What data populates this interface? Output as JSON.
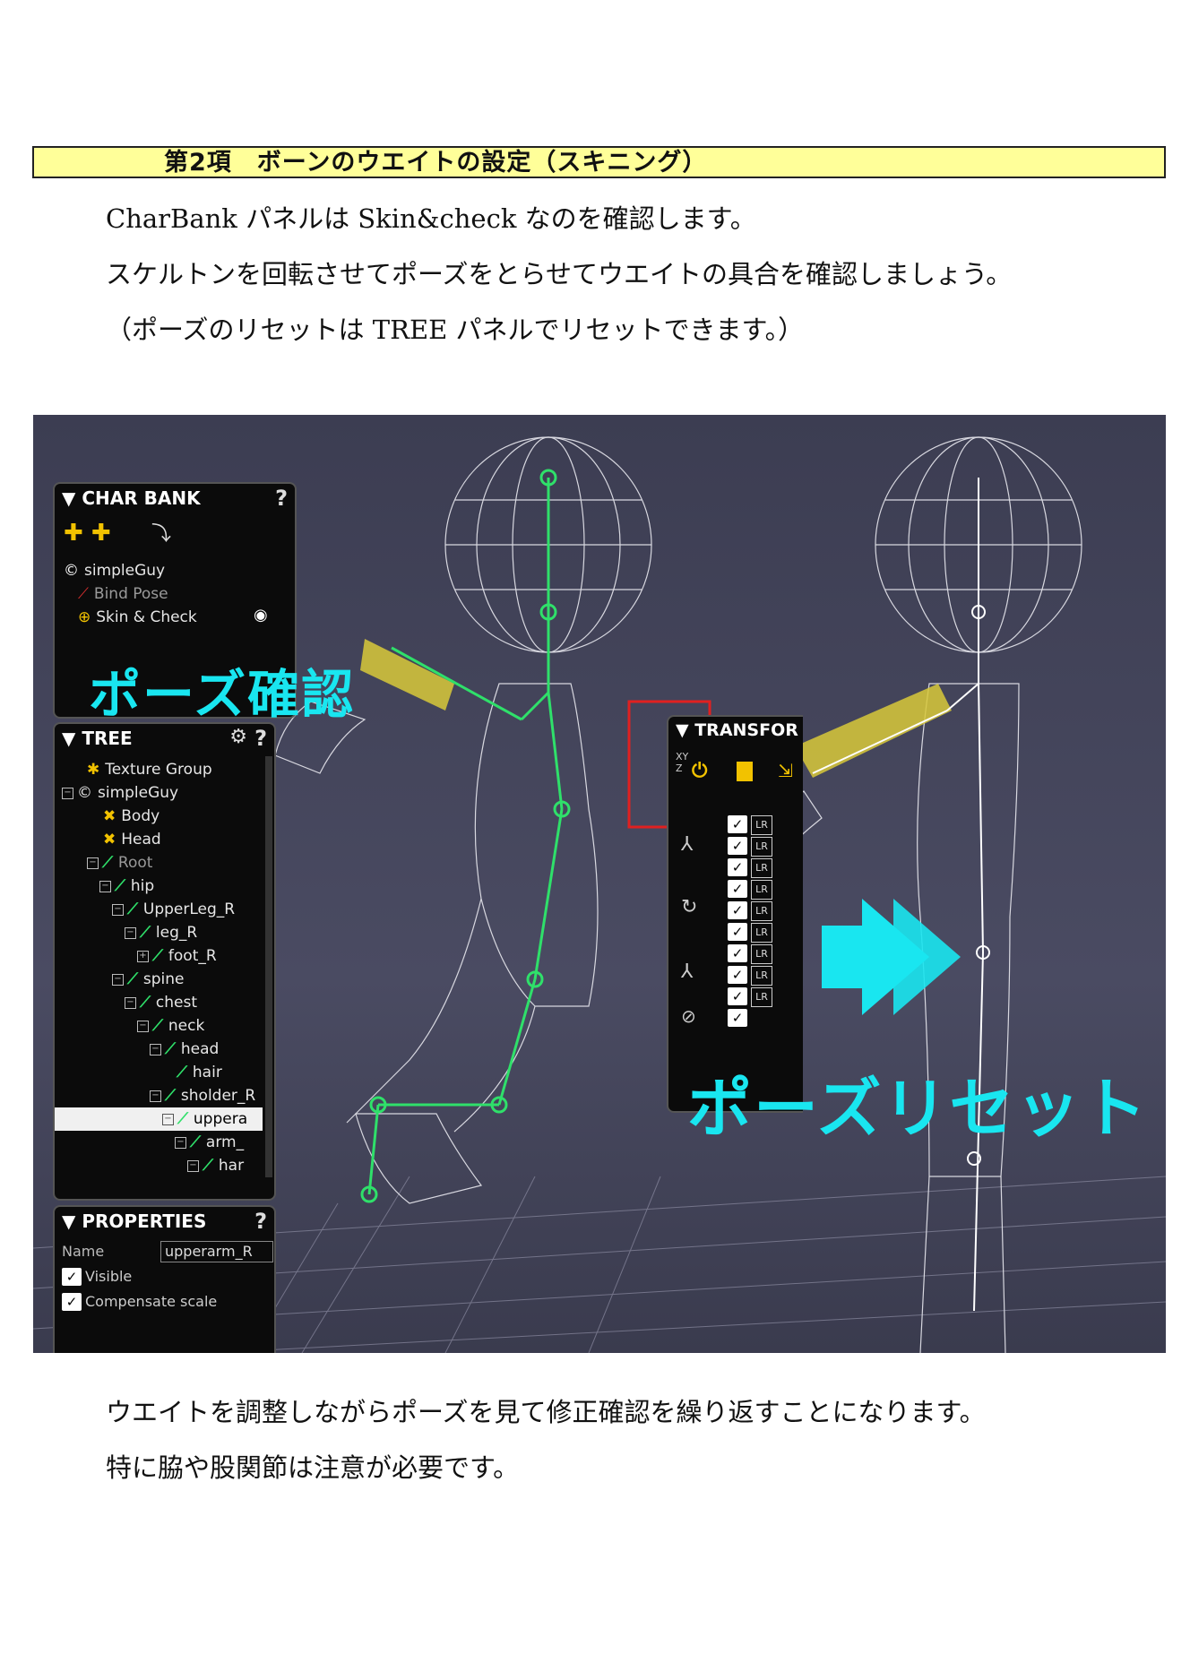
{
  "section": {
    "title": "第2項　ボーンのウエイトの設定（スキニング）"
  },
  "intro": [
    "CharBank パネルは Skin&check なのを確認します。",
    "スケルトンを回転させてポーズをとらせてウエイトの具合を確認しましょう。",
    "（ポーズのリセットは TREE パネルでリセットできます。）"
  ],
  "screenshot": {
    "charbank": {
      "title": "▼ CHAR BANK",
      "help": "?",
      "items": [
        "simpleGuy",
        "Bind Pose",
        "Skin & Check"
      ]
    },
    "tree": {
      "title": "▼ TREE",
      "help": "?",
      "rows": [
        "Texture Group",
        "simpleGuy",
        "Body",
        "Head",
        "Root",
        "hip",
        "UpperLeg_R",
        "leg_R",
        "foot_R",
        "spine",
        "chest",
        "neck",
        "head",
        "hair",
        "sholder_R",
        "uppera",
        "arm_",
        "har"
      ]
    },
    "properties": {
      "title": "▼ PROPERTIES",
      "help": "?",
      "name_label": "Name",
      "name_value": "upperarm_R",
      "visible_label": "Visible",
      "compensate_label": "Compensate scale"
    },
    "transform": {
      "title": "▼ TRANSFOR",
      "xyz": "XY Z",
      "lr": "LR"
    },
    "callouts": {
      "pose_check": "ポーズ確認",
      "pose_reset": "ポーズリセット"
    }
  },
  "outro": [
    "ウエイトを調整しながらポーズを見て修正確認を繰り返すことになります。",
    "特に脇や股関節は注意が必要です。"
  ],
  "colors": {
    "header_bg": "#ffff99",
    "callout": "#19e6f0",
    "bone": "#2fe06a",
    "highlight_box": "#e02020"
  }
}
